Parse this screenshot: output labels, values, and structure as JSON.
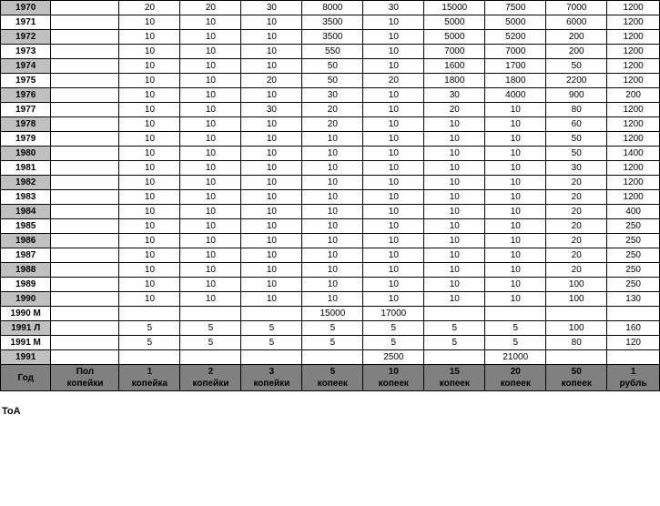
{
  "table": {
    "columns": [
      "Год",
      "Пол копейки",
      "1 копейка",
      "2 копейки",
      "3 копейки",
      "5 копеек",
      "10 копеек",
      "15 копеек",
      "20 копеек",
      "50 копеек",
      "1 рубль"
    ],
    "rows": [
      [
        "1970",
        "",
        "20",
        "20",
        "30",
        "8000",
        "30",
        "15000",
        "7500",
        "7000",
        "1200"
      ],
      [
        "1971",
        "",
        "10",
        "10",
        "10",
        "3500",
        "10",
        "5000",
        "5000",
        "6000",
        "1200"
      ],
      [
        "1972",
        "",
        "10",
        "10",
        "10",
        "3500",
        "10",
        "5000",
        "5200",
        "200",
        "1200"
      ],
      [
        "1973",
        "",
        "10",
        "10",
        "10",
        "550",
        "10",
        "7000",
        "7000",
        "200",
        "1200"
      ],
      [
        "1974",
        "",
        "10",
        "10",
        "10",
        "50",
        "10",
        "1600",
        "1700",
        "50",
        "1200"
      ],
      [
        "1975",
        "",
        "10",
        "10",
        "20",
        "50",
        "20",
        "1800",
        "1800",
        "2200",
        "1200"
      ],
      [
        "1976",
        "",
        "10",
        "10",
        "10",
        "30",
        "10",
        "30",
        "4000",
        "900",
        "200"
      ],
      [
        "1977",
        "",
        "10",
        "10",
        "30",
        "20",
        "10",
        "20",
        "10",
        "80",
        "1200"
      ],
      [
        "1978",
        "",
        "10",
        "10",
        "10",
        "20",
        "10",
        "10",
        "10",
        "60",
        "1200"
      ],
      [
        "1979",
        "",
        "10",
        "10",
        "10",
        "10",
        "10",
        "10",
        "10",
        "50",
        "1200"
      ],
      [
        "1980",
        "",
        "10",
        "10",
        "10",
        "10",
        "10",
        "10",
        "10",
        "50",
        "1400"
      ],
      [
        "1981",
        "",
        "10",
        "10",
        "10",
        "10",
        "10",
        "10",
        "10",
        "30",
        "1200"
      ],
      [
        "1982",
        "",
        "10",
        "10",
        "10",
        "10",
        "10",
        "10",
        "10",
        "20",
        "1200"
      ],
      [
        "1983",
        "",
        "10",
        "10",
        "10",
        "10",
        "10",
        "10",
        "10",
        "20",
        "1200"
      ],
      [
        "1984",
        "",
        "10",
        "10",
        "10",
        "10",
        "10",
        "10",
        "10",
        "20",
        "400"
      ],
      [
        "1985",
        "",
        "10",
        "10",
        "10",
        "10",
        "10",
        "10",
        "10",
        "20",
        "250"
      ],
      [
        "1986",
        "",
        "10",
        "10",
        "10",
        "10",
        "10",
        "10",
        "10",
        "20",
        "250"
      ],
      [
        "1987",
        "",
        "10",
        "10",
        "10",
        "10",
        "10",
        "10",
        "10",
        "20",
        "250"
      ],
      [
        "1988",
        "",
        "10",
        "10",
        "10",
        "10",
        "10",
        "10",
        "10",
        "20",
        "250"
      ],
      [
        "1989",
        "",
        "10",
        "10",
        "10",
        "10",
        "10",
        "10",
        "10",
        "100",
        "250"
      ],
      [
        "1990",
        "",
        "10",
        "10",
        "10",
        "10",
        "10",
        "10",
        "10",
        "100",
        "130"
      ],
      [
        "1990 М",
        "",
        "",
        "",
        "",
        "15000",
        "17000",
        "",
        "",
        "",
        ""
      ],
      [
        "1991 Л",
        "",
        "5",
        "5",
        "5",
        "5",
        "5",
        "5",
        "5",
        "100",
        "160"
      ],
      [
        "1991 М",
        "",
        "5",
        "5",
        "5",
        "5",
        "5",
        "5",
        "5",
        "80",
        "120"
      ],
      [
        "1991",
        "",
        "",
        "",
        "",
        "",
        "2500",
        "",
        "21000",
        "",
        ""
      ]
    ],
    "footer": [
      "Год",
      "Пол копейки",
      "1 копейка",
      "2 копейки",
      "3 копейки",
      "5 копеек",
      "10 копеек",
      "15 копеек",
      "20 копеек",
      "50 копеек",
      "1 рубль"
    ],
    "toa_label": "ToA"
  }
}
